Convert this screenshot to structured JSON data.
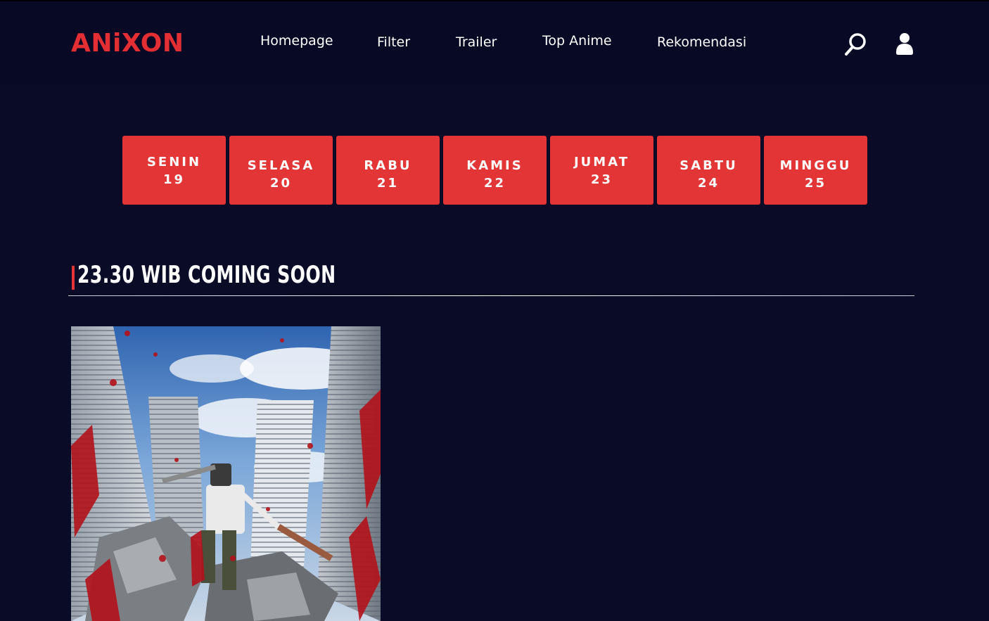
{
  "header": {
    "logo": "ANiXON",
    "nav": [
      "Homepage",
      "Filter",
      "Trailer",
      "Top Anime",
      "Rekomendasi"
    ],
    "icons": [
      "search-icon",
      "user-icon"
    ]
  },
  "schedule": {
    "days": [
      {
        "name": "SENIN",
        "date": "19"
      },
      {
        "name": "SELASA",
        "date": "20"
      },
      {
        "name": "RABU",
        "date": "21"
      },
      {
        "name": "KAMIS",
        "date": "22"
      },
      {
        "name": "JUMAT",
        "date": "23"
      },
      {
        "name": "SABTU",
        "date": "24"
      },
      {
        "name": "MINGGU",
        "date": "25"
      }
    ]
  },
  "section": {
    "title": "23.30 WIB COMING SOON"
  },
  "colors": {
    "background": "#0a0b26",
    "header": "#080925",
    "accent": "#e33535",
    "logo": "#e32f33"
  }
}
